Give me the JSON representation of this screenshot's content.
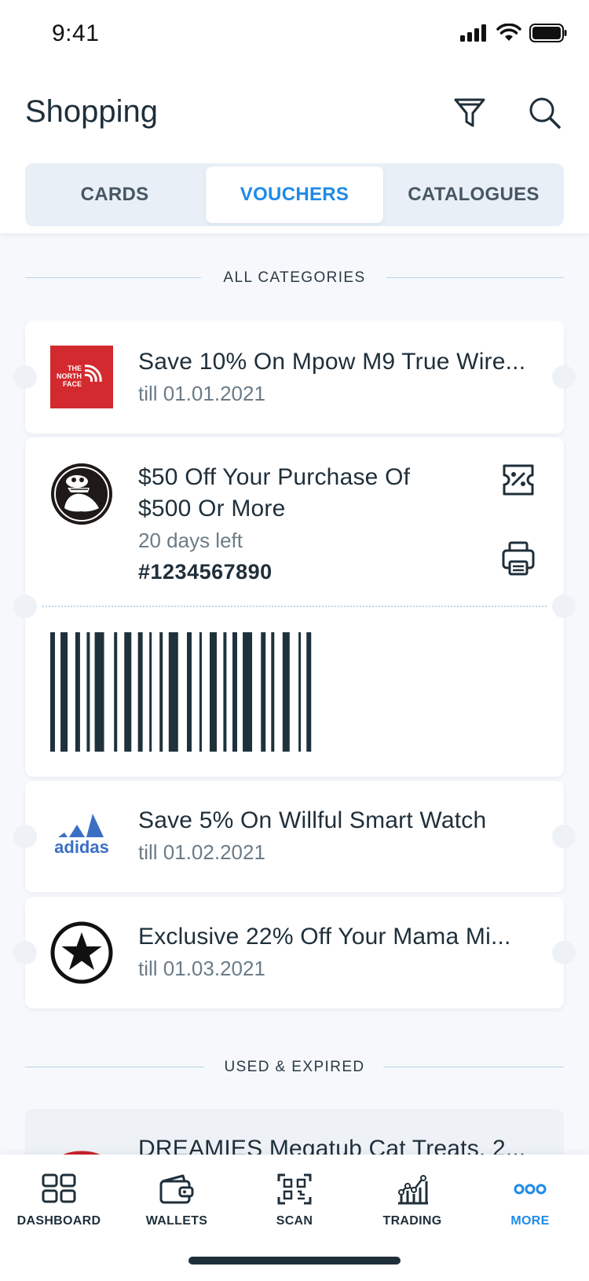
{
  "status_bar": {
    "time": "9:41"
  },
  "header": {
    "title": "Shopping"
  },
  "tabs": [
    {
      "label": "CARDS"
    },
    {
      "label": "VOUCHERS"
    },
    {
      "label": "CATALOGUES"
    }
  ],
  "sections": {
    "all_categories": "ALL CATEGORIES",
    "used_expired": "USED & EXPIRED"
  },
  "vouchers": [
    {
      "brand": "The North Face",
      "logo_text": [
        "THE",
        "NORTH",
        "FACE"
      ],
      "title": "Save 10% On Mpow M9 True Wire...",
      "subtitle": "till 01.01.2021"
    },
    {
      "brand": "Crocs",
      "title_line1": "$50 Off Your Purchase Of",
      "title_line2": "$500 Or More",
      "subtitle": "20 days left",
      "code": "#1234567890"
    },
    {
      "brand": "adidas",
      "logo_text": "adidas",
      "title": "Save 5% On Willful Smart Watch",
      "subtitle": "till 01.02.2021"
    },
    {
      "brand": "Converse",
      "title": "Exclusive 22% Off Your Mama Mi...",
      "subtitle": "till 01.03.2021"
    }
  ],
  "expired": [
    {
      "title": "DREAMIES Megatub Cat Treats, 2..."
    }
  ],
  "bottom_nav": [
    {
      "label": "DASHBOARD",
      "icon": "dashboard-icon"
    },
    {
      "label": "WALLETS",
      "icon": "wallet-icon"
    },
    {
      "label": "SCAN",
      "icon": "qr-scan-icon"
    },
    {
      "label": "TRADING",
      "icon": "trading-chart-icon"
    },
    {
      "label": "MORE",
      "icon": "more-dots-icon"
    }
  ],
  "colors": {
    "accent": "#1f8ae8",
    "text": "#1f2f3a",
    "muted": "#6b7c88",
    "tab_bg": "#e8eff6",
    "north_face_red": "#d22a2e",
    "adidas_blue": "#3a6fc4"
  }
}
